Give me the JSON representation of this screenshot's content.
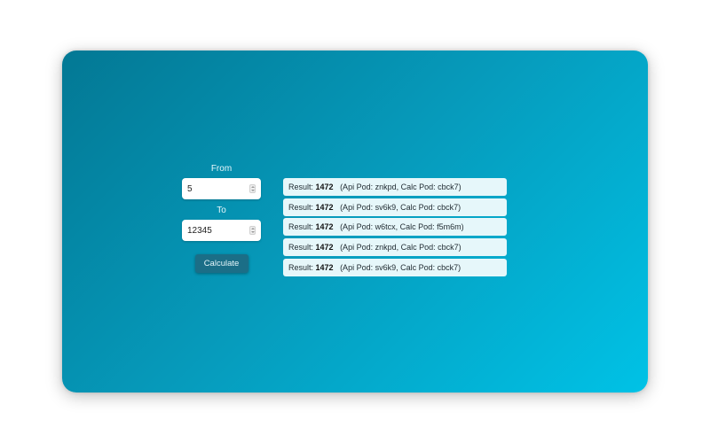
{
  "form": {
    "from_label": "From",
    "from_value": "5",
    "to_label": "To",
    "to_value": "12345",
    "calculate_label": "Calculate"
  },
  "results": [
    {
      "prefix": "Result:",
      "value": "1472",
      "detail": "(Api Pod: znkpd, Calc Pod: cbck7)"
    },
    {
      "prefix": "Result:",
      "value": "1472",
      "detail": "(Api Pod: sv6k9, Calc Pod: cbck7)"
    },
    {
      "prefix": "Result:",
      "value": "1472",
      "detail": "(Api Pod: w6tcx, Calc Pod: f5m6m)"
    },
    {
      "prefix": "Result:",
      "value": "1472",
      "detail": "(Api Pod: znkpd, Calc Pod: cbck7)"
    },
    {
      "prefix": "Result:",
      "value": "1472",
      "detail": "(Api Pod: sv6k9, Calc Pod: cbck7)"
    }
  ]
}
